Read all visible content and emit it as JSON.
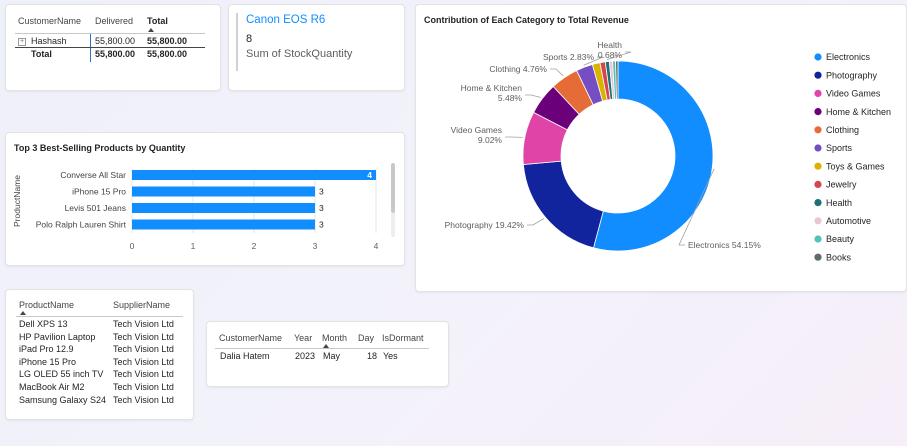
{
  "matrix": {
    "headers": [
      "CustomerName",
      "Delivered",
      "Total"
    ],
    "rows": [
      {
        "label": "Hashash",
        "expand": "+",
        "delivered": "55,800.00",
        "total": "55,800.00"
      },
      {
        "label": "Total",
        "delivered": "55,800.00",
        "total": "55,800.00"
      }
    ]
  },
  "card": {
    "title": "Canon EOS R6",
    "value": "8",
    "label": "Sum of StockQuantity",
    "accent": "#118dff"
  },
  "bar_chart": {
    "title": "Top 3 Best-Selling Products by Quantity"
  },
  "supplier_table": {
    "headers": [
      "ProductName",
      "SupplierName"
    ],
    "rows": [
      [
        "Dell XPS 13",
        "Tech Vision Ltd"
      ],
      [
        "HP Pavilion Laptop",
        "Tech Vision Ltd"
      ],
      [
        "iPad Pro 12.9",
        "Tech Vision Ltd"
      ],
      [
        "iPhone 15 Pro",
        "Tech Vision Ltd"
      ],
      [
        "LG OLED 55 inch TV",
        "Tech Vision Ltd"
      ],
      [
        "MacBook Air M2",
        "Tech Vision Ltd"
      ],
      [
        "Samsung Galaxy S24",
        "Tech Vision Ltd"
      ]
    ]
  },
  "customer_table": {
    "headers": [
      "CustomerName",
      "Year",
      "Month",
      "Day",
      "IsDormant"
    ],
    "rows": [
      [
        "Dalia Hatem",
        "2023",
        "May",
        "18",
        "Yes"
      ]
    ]
  },
  "donut": {
    "title": "Contribution of Each Category to Total Revenue"
  },
  "chart_data": [
    {
      "type": "bar",
      "orientation": "horizontal",
      "title": "Top 3 Best-Selling Products by Quantity",
      "ylabel": "ProductName",
      "xlabel": "",
      "categories": [
        "Converse All Star",
        "iPhone 15 Pro",
        "Levis 501 Jeans",
        "Polo Ralph Lauren Shirt"
      ],
      "values": [
        4,
        3,
        3,
        3
      ],
      "xticks": [
        "0",
        "1",
        "2",
        "3",
        "4"
      ],
      "xlim": [
        0,
        4
      ],
      "color": "#118dff"
    },
    {
      "type": "pie",
      "donut": true,
      "title": "Contribution of Each Category to Total Revenue",
      "categories": [
        "Electronics",
        "Photography",
        "Video Games",
        "Home & Kitchen",
        "Clothing",
        "Sports",
        "Toys & Games",
        "Jewelry",
        "Health",
        "Automotive",
        "Beauty",
        "Books"
      ],
      "values": [
        54.15,
        19.42,
        9.02,
        5.48,
        4.76,
        2.83,
        1.3,
        0.9,
        0.68,
        0.55,
        0.5,
        0.41
      ],
      "colors": [
        "#118dff",
        "#12239e",
        "#e044a7",
        "#6b007b",
        "#e66c37",
        "#744ec2",
        "#d9b300",
        "#d64550",
        "#197278",
        "#e8c6d7",
        "#4dc4b6",
        "#5f6b6d"
      ],
      "data_labels": [
        {
          "category": "Electronics",
          "text": "Electronics 54.15%"
        },
        {
          "category": "Photography",
          "text": "Photography 19.42%"
        },
        {
          "category": "Video Games",
          "text": "Video Games\n9.02%"
        },
        {
          "category": "Home & Kitchen",
          "text": "Home & Kitchen\n5.48%"
        },
        {
          "category": "Clothing",
          "text": "Clothing 4.76%"
        },
        {
          "category": "Sports",
          "text": "Sports 2.83%"
        },
        {
          "category": "Health",
          "text": "Health\n0.68%"
        }
      ],
      "legend": "right"
    }
  ]
}
